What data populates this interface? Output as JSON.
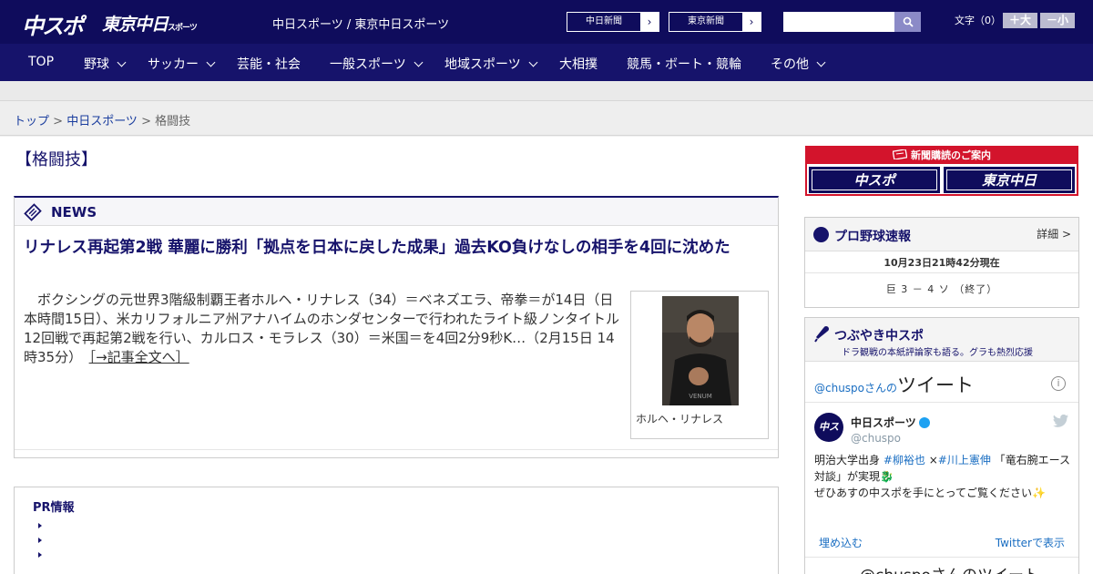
{
  "header": {
    "logo_chuspo": "中スポ",
    "logo_tokyo": "東京中日",
    "logo_tokyo_small": "スポーツ",
    "site_names": "中日スポーツ / 東京中日スポーツ",
    "paper_buttons": [
      {
        "label": "中日新聞",
        "arrow": "›"
      },
      {
        "label": "東京新聞",
        "arrow": "›"
      }
    ],
    "search_placeholder": "",
    "font_label": "文字（0）",
    "font_bigger": "＋大",
    "font_smaller": "－小"
  },
  "nav": {
    "items": [
      {
        "label": "TOP"
      },
      {
        "label": "野球"
      },
      {
        "label": "サッカー"
      },
      {
        "label": "芸能・社会"
      },
      {
        "label": "一般スポーツ"
      },
      {
        "label": "地域スポーツ"
      },
      {
        "label": "大相撲"
      },
      {
        "label": "競馬・ボート・競輪"
      },
      {
        "label": "その他"
      }
    ]
  },
  "breadcrumb": {
    "top": "トップ",
    "sep1": " > ",
    "chunichi": "中日スポーツ",
    "sep2": " > ",
    "current": "格闘技"
  },
  "category_title": "【格闘技】",
  "news": {
    "section_label": "NEWS",
    "headline": "リナレス再起第2戦 華麗に勝利「拠点を日本に戻した成果」過去KO負けなしの相手を4回に沈めた",
    "excerpt": "ボクシングの元世界3階級制覇王者ホルヘ・リナレス（34）＝ベネズエラ、帝拳＝が14日（日本時間15日）、米カリフォルニア州アナハイムのホンダセンターで行われたライト級ノンタイトル12回戦で再起第2戦を行い、カルロス・モラレス（30）＝米国＝を4回2分9秒K…（2月15日 14時35分）",
    "more_link": "［→記事全文へ］",
    "photo_caption": "ホルヘ・リナレス"
  },
  "pr": {
    "title": "PR情報"
  },
  "subscription": {
    "title": "新聞購読のご案内",
    "btn_chuspo": "中スポ",
    "btn_tokyo": "東京中日"
  },
  "baseball": {
    "title": "プロ野球速報",
    "detail": "詳細 >",
    "timestamp": "10月23日21時42分現在",
    "score": "巨 3 － 4 ソ （終了）"
  },
  "tweet": {
    "title": "つぶやき中スポ",
    "subtitle": "ドラ観戦の本紙評論家も語る。グラも熱烈応援",
    "timeline_handle": "@chuspo",
    "timeline_suffix": "さんの",
    "timeline_title": "ツイート",
    "info_symbol": "i",
    "avatar_text": "中スポ",
    "name": "中日スポーツ",
    "handle": "@chuspo",
    "text_prefix": "明治大学出身 ",
    "tag1": "#柳裕也",
    "text_mid": " ×",
    "tag2": "#川上憲伸",
    "text_rest": " 「竜右腕エース対談」が実現🐉",
    "text_line2": "ぜひあすの中スポを手にとってご覧ください✨",
    "embed": "埋め込む",
    "view_on_twitter": "Twitterで表示",
    "bottom_text": "@chuspoさんのツイート"
  },
  "colors": {
    "brand_navy": "#0f0c5c",
    "nav_navy": "#16136b",
    "subscription_red": "#d3142c",
    "link_blue": "#1a3d9e"
  }
}
